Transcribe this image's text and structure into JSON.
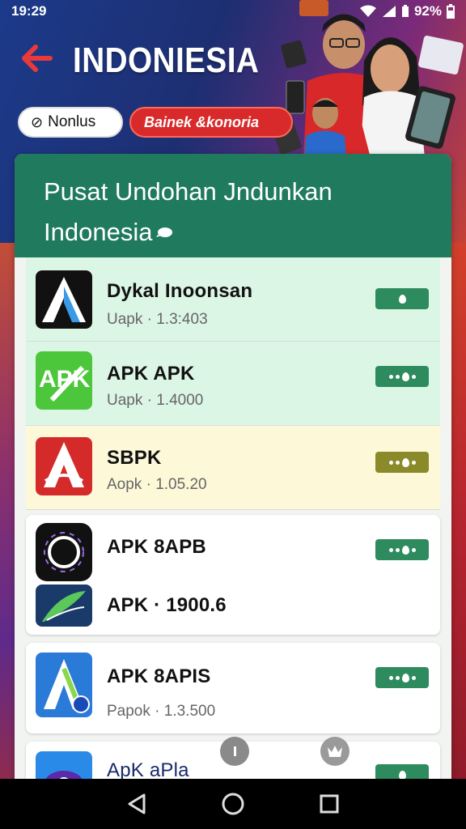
{
  "status": {
    "time": "19:29",
    "battery": "92%"
  },
  "header": {
    "title": "INDONIESIA",
    "chip_left": "Nonlus",
    "chip_right": "Bainek &konoria"
  },
  "card": {
    "title": "Pusat Undohan Jndunkan",
    "subtitle": "Indonesia"
  },
  "apps": [
    {
      "name": "Dykal Inoonsan",
      "meta": "Uapk · 1.3:403",
      "button": "single"
    },
    {
      "name": "APK APK",
      "meta": "Uapk · 1.4000",
      "button": "dots"
    },
    {
      "name": "SBPK",
      "meta": "Aopk · 1.05.20",
      "button": "dots"
    },
    {
      "name": "APK 8APB",
      "meta": "",
      "button": "dots"
    },
    {
      "name": "APK · 1900.6",
      "meta": "",
      "button": "none"
    },
    {
      "name": "APK 8APIS",
      "meta": "Papok · 1.3.500",
      "button": "dots"
    },
    {
      "name": "ApK aPla",
      "meta": "",
      "button": "single"
    }
  ],
  "icons": {
    "back": "back-arrow-icon",
    "nav": [
      "back-triangle-icon",
      "home-circle-icon",
      "recents-square-icon"
    ]
  },
  "colors": {
    "header_green": "#1f7a5e",
    "button_green": "#2e8b5e",
    "button_olive": "#8a8a2a",
    "chip_red": "#d82a2a"
  }
}
